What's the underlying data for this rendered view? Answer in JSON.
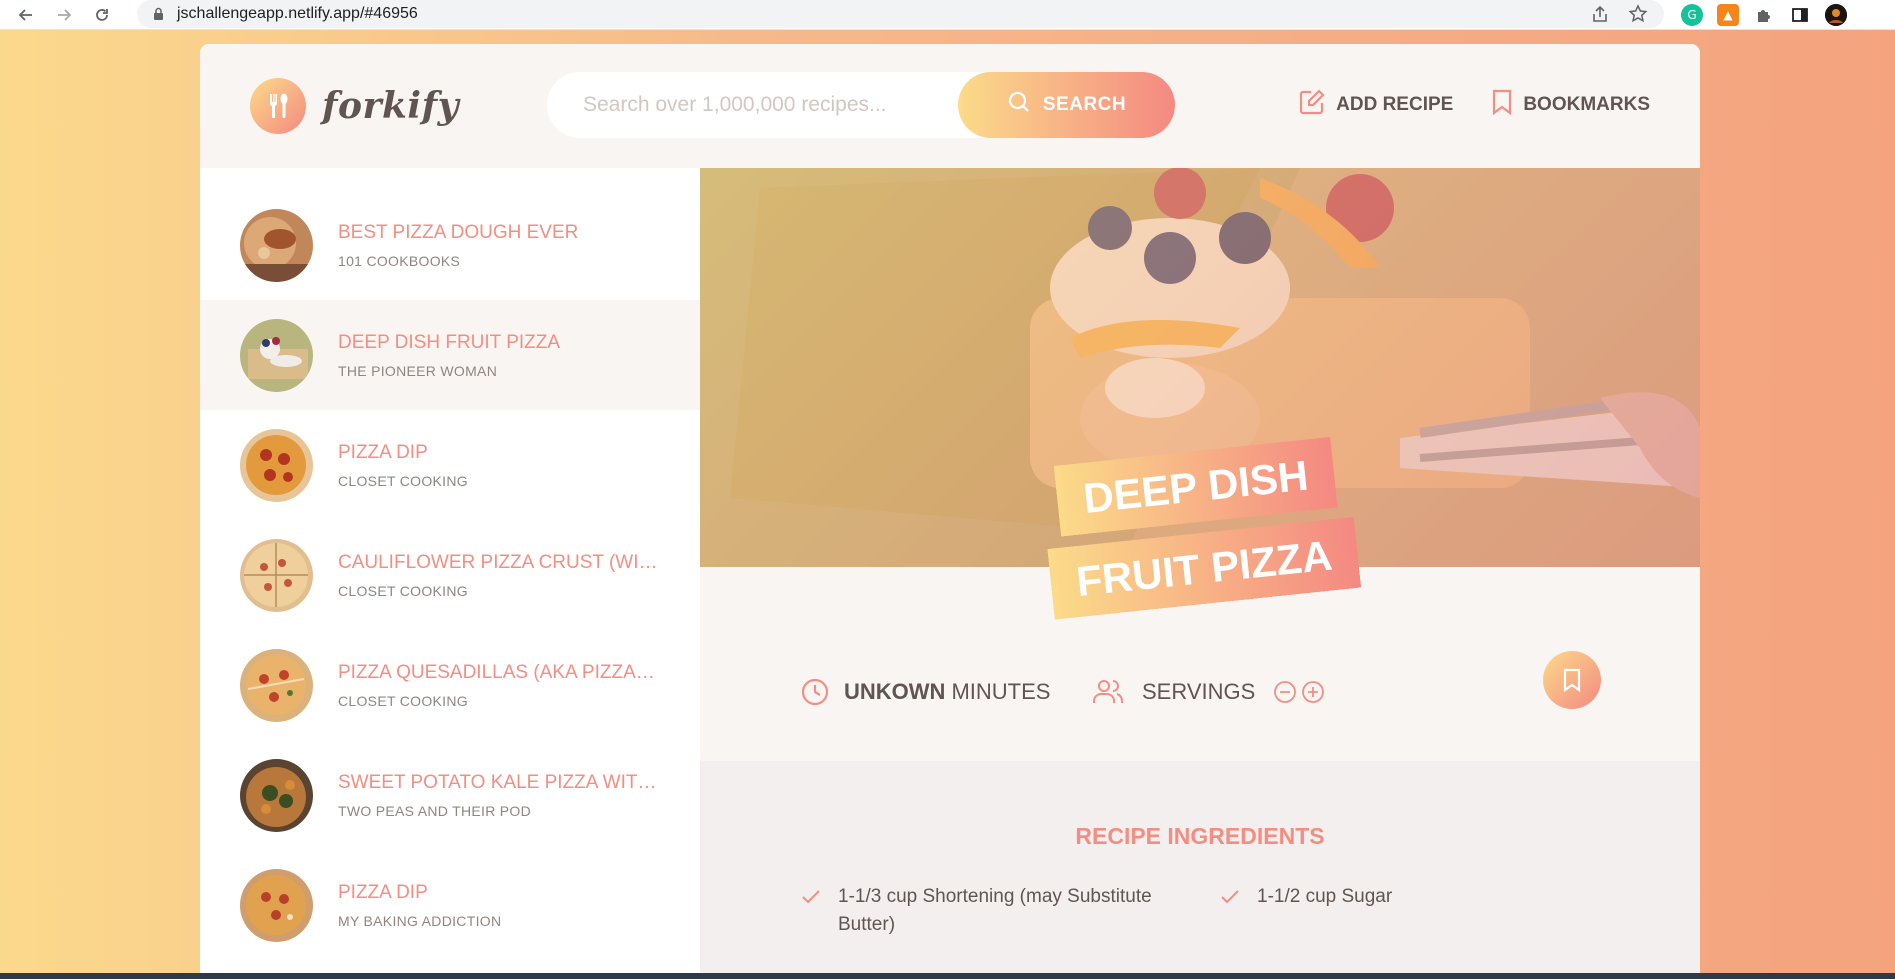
{
  "browser": {
    "url": "jschallengeapp.netlify.app/#46956"
  },
  "header": {
    "logo_text": "forkify",
    "search_placeholder": "Search over 1,000,000 recipes...",
    "search_button": "SEARCH",
    "add_recipe": "ADD RECIPE",
    "bookmarks": "BOOKMARKS"
  },
  "results": [
    {
      "title": "BEST PIZZA DOUGH EVER",
      "publisher": "101 COOKBOOKS"
    },
    {
      "title": "DEEP DISH FRUIT PIZZA",
      "publisher": "THE PIONEER WOMAN"
    },
    {
      "title": "PIZZA DIP",
      "publisher": "CLOSET COOKING"
    },
    {
      "title": "CAULIFLOWER PIZZA CRUST (WIT...",
      "publisher": "CLOSET COOKING"
    },
    {
      "title": "PIZZA QUESADILLAS (AKA PIZZAD...",
      "publisher": "CLOSET COOKING"
    },
    {
      "title": "SWEET POTATO KALE PIZZA WITH...",
      "publisher": "TWO PEAS AND THEIR POD"
    },
    {
      "title": "PIZZA DIP",
      "publisher": "MY BAKING ADDICTION"
    }
  ],
  "active_result_index": 1,
  "recipe": {
    "title": "DEEP DISH FRUIT PIZZA",
    "time_value": "UNKOWN",
    "time_unit": "MINUTES",
    "servings_label": "SERVINGS",
    "ingredients_heading": "RECIPE INGREDIENTS",
    "ingredients": [
      "1-1/3 cup Shortening (may Substitute Butter)",
      "1-1/2 cup Sugar"
    ]
  },
  "colors": {
    "accent_start": "#fbdb89",
    "accent_end": "#f48982",
    "title_color": "#f38e82",
    "text_color": "#615551",
    "panel_bg": "#f9f5f3"
  }
}
